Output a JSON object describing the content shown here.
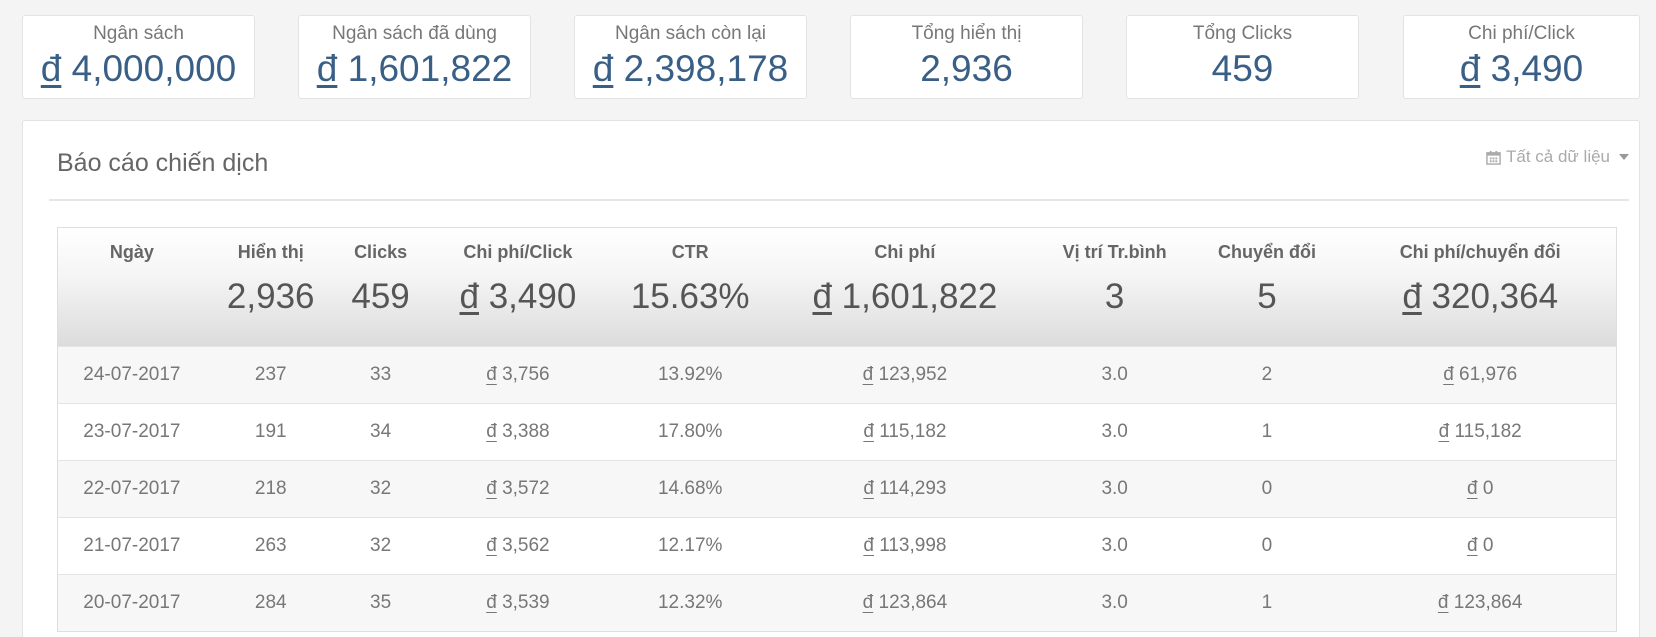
{
  "stats": [
    {
      "label": "Ngân sách",
      "currency": "đ",
      "value": "4,000,000"
    },
    {
      "label": "Ngân sách đã dùng",
      "currency": "đ",
      "value": "1,601,822"
    },
    {
      "label": "Ngân sách còn lại",
      "currency": "đ",
      "value": "2,398,178"
    },
    {
      "label": "Tổng hiển thị",
      "currency": "",
      "value": "2,936"
    },
    {
      "label": "Tổng Clicks",
      "currency": "",
      "value": "459"
    },
    {
      "label": "Chi phí/Click",
      "currency": "đ",
      "value": "3,490"
    }
  ],
  "report": {
    "title": "Báo cáo chiến dịch",
    "filter_label": "Tất cả dữ liệu",
    "filter_icon": "calendar-icon",
    "columns": [
      {
        "label": "Ngày",
        "total": "",
        "currency": ""
      },
      {
        "label": "Hiển thị",
        "total": "2,936",
        "currency": ""
      },
      {
        "label": "Clicks",
        "total": "459",
        "currency": ""
      },
      {
        "label": "Chi phí/Click",
        "total": "3,490",
        "currency": "đ"
      },
      {
        "label": "CTR",
        "total": "15.63%",
        "currency": ""
      },
      {
        "label": "Chi phí",
        "total": "1,601,822",
        "currency": "đ"
      },
      {
        "label": "Vị trí Tr.bình",
        "total": "3",
        "currency": ""
      },
      {
        "label": "Chuyển đổi",
        "total": "5",
        "currency": ""
      },
      {
        "label": "Chi phí/chuyển đổi",
        "total": "320,364",
        "currency": "đ"
      }
    ],
    "rows": [
      {
        "date": "24-07-2017",
        "impressions": "237",
        "clicks": "33",
        "cpc": "3,756",
        "ctr": "13.92%",
        "cost": "123,952",
        "avg_pos": "3.0",
        "conversions": "2",
        "cost_per_conv": "61,976"
      },
      {
        "date": "23-07-2017",
        "impressions": "191",
        "clicks": "34",
        "cpc": "3,388",
        "ctr": "17.80%",
        "cost": "115,182",
        "avg_pos": "3.0",
        "conversions": "1",
        "cost_per_conv": "115,182"
      },
      {
        "date": "22-07-2017",
        "impressions": "218",
        "clicks": "32",
        "cpc": "3,572",
        "ctr": "14.68%",
        "cost": "114,293",
        "avg_pos": "3.0",
        "conversions": "0",
        "cost_per_conv": "0"
      },
      {
        "date": "21-07-2017",
        "impressions": "263",
        "clicks": "32",
        "cpc": "3,562",
        "ctr": "12.17%",
        "cost": "113,998",
        "avg_pos": "3.0",
        "conversions": "0",
        "cost_per_conv": "0"
      },
      {
        "date": "20-07-2017",
        "impressions": "284",
        "clicks": "35",
        "cpc": "3,539",
        "ctr": "12.32%",
        "cost": "123,864",
        "avg_pos": "3.0",
        "conversions": "1",
        "cost_per_conv": "123,864"
      }
    ]
  },
  "colors": {
    "accent": "#3a5f86",
    "muted_text": "#777777",
    "card_border": "#e3e3e3"
  }
}
